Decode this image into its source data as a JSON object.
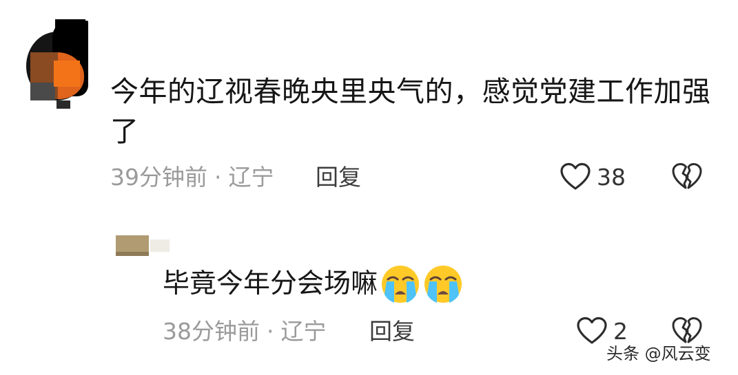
{
  "comment": {
    "text": "今年的辽视春晚央里央气的，感觉党建工作加强了",
    "time": "39分钟前",
    "separator": "·",
    "location": "辽宁",
    "reply_label": "回复",
    "like_count": "38"
  },
  "reply": {
    "text": "毕竟今年分会场嘛",
    "time": "38分钟前",
    "separator": "·",
    "location": "辽宁",
    "reply_label": "回复",
    "like_count": "2"
  },
  "watermark": "头条 @风云变",
  "icons": {
    "like": "heart-outline-icon",
    "dislike": "broken-heart-icon",
    "emoji": "loudly-crying-face-icon"
  },
  "colors": {
    "text": "#161616",
    "meta": "#9a9a9a",
    "reply": "#3c3c3c",
    "emoji_face": "#ffca28",
    "emoji_tears": "#4fc3f7"
  }
}
